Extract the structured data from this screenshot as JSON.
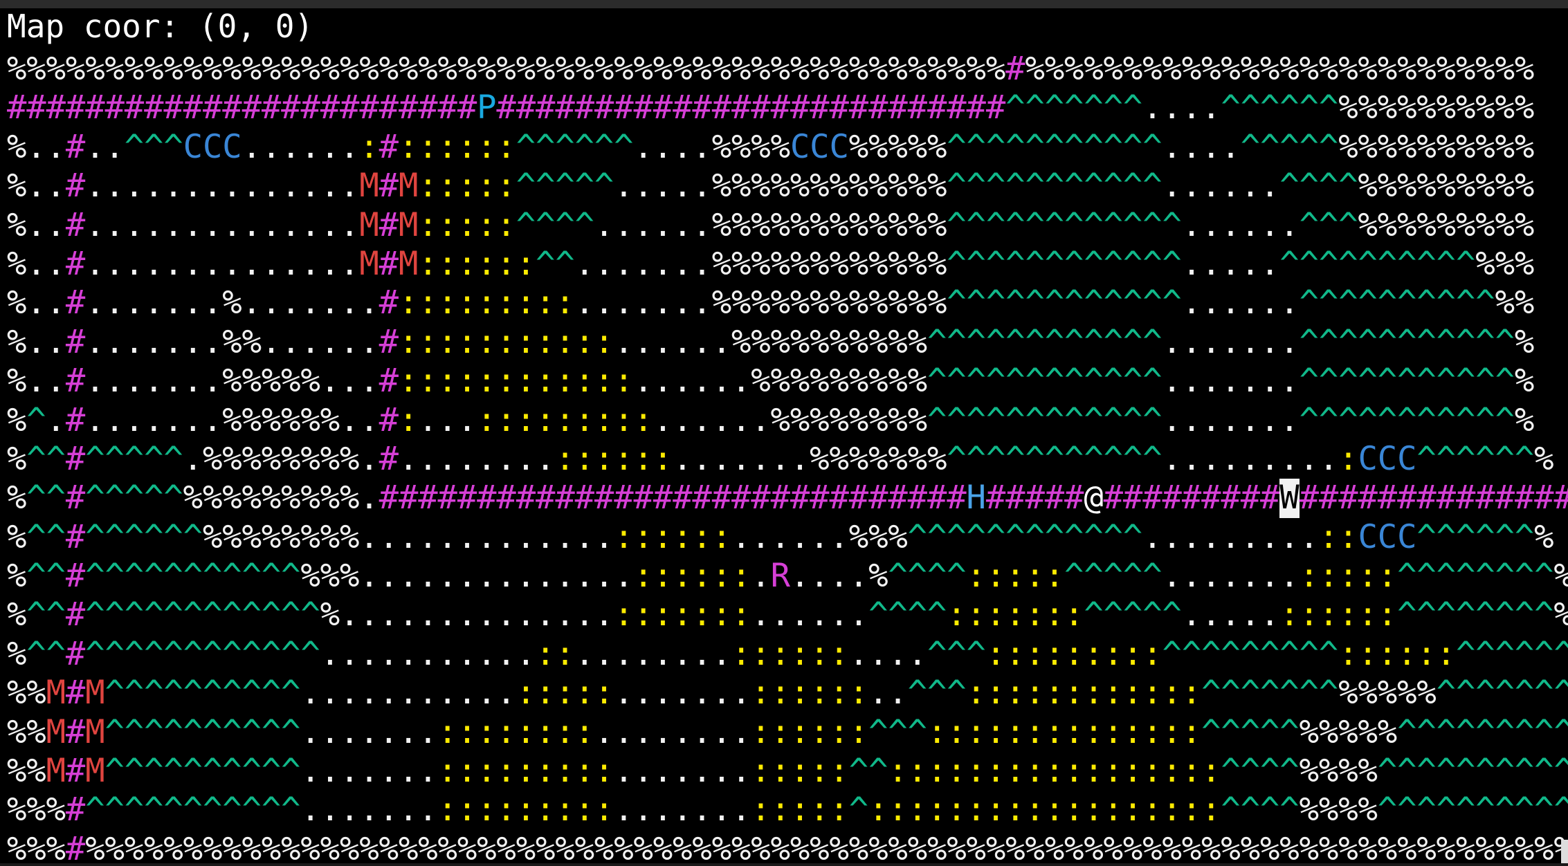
{
  "status": {
    "label": "Map coor: (0, 0)"
  },
  "legend": {
    "%": "c-rock",
    "#": "c-wall",
    ".": "c-floor",
    ":": "c-grass",
    "^": "c-mount",
    "C": "c-tree",
    "M": "c-mon",
    "P": "c-shop",
    "H": "c-unit",
    "R": "c-npc",
    "@": "c-player",
    "W": "c-cursor"
  },
  "grid": [
    "%%%%%%%%%%%%%%%%%%%%%%%%%%%%%%%%%%%%%%%%%%%%%%%%%%%#%%%%%%%%%%%%%%%%%%%%%%%%%%",
    "########################P##########################^^^^^^^....^^^^^^%%%%%%%%%%",
    "%..#..^^^CCC......:#::::::^^^^^^....%%%%CCC%%%%%^^^^^^^^^^^....^^^^^%%%%%%%%%%",
    "%..#..............M#M:::::^^^^^.....%%%%%%%%%%%%^^^^^^^^^^^......^^^^%%%%%%%%%",
    "%..#..............M#M:::::^^^^......%%%%%%%%%%%%^^^^^^^^^^^^......^^^%%%%%%%%%",
    "%..#..............M#M::::::^^.......%%%%%%%%%%%%^^^^^^^^^^^^.....^^^^^^^^^^%%%",
    "%..#.......%.......#:::::::::.......%%%%%%%%%%%%^^^^^^^^^^^^......^^^^^^^^^^%%",
    "%..#.......%%......#:::::::::::......%%%%%%%%%%^^^^^^^^^^^^.......^^^^^^^^^^^%",
    "%..#.......%%%%%...#::::::::::::......%%%%%%%%%^^^^^^^^^^^^.......^^^^^^^^^^^%",
    "%^.#.......%%%%%%..#:...:::::::::......%%%%%%%%^^^^^^^^^^^^.......^^^^^^^^^^^%",
    "%^^#^^^^^.%%%%%%%%.#........::::::.......%%%%%%%^^^^^^^^^^^.........:CCC^^^^^^%",
    "%^^#^^^^^%%%%%%%%%.##############################H#####@#########W###############",
    "%^^#^^^^^^%%%%%%%%.............::::::......%%%^^^^^^^^^^^^.........::CCC^^^^^^%",
    "%^^#^^^^^^^^^^^%%%..............::::::.R....%^^^^:::::^^^^^.......:::::^^^^^^^^%",
    "%^^#^^^^^^^^^^^^%..............:::::::......^^^^:::::::^^^^^.....::::::^^^^^^^^%",
    "%^^#^^^^^^^^^^^^...........::........::::::....^^^:::::::::^^^^^^^^^::::::^^^^^^^%",
    "%%M#M^^^^^^^^^^...........:::::.......::::::..^^^::::::::::::^^^^^^^%%%%%^^^^^^^^%",
    "%%M#M^^^^^^^^^^.......::::::::........::::::^^^::::::::::::::^^^^^%%%%%^^^^^^^^^^%",
    "%%M#M^^^^^^^^^^.......:::::::::.......:::::^^:::::::::::::::::^^^^%%%%^^^^^^^^^^^%",
    "%%%#^^^^^^^^^^^.......:::::::::.......:::::^::::::::::::::::::^^^^%%%%^^^^^^^^^^^%",
    "%%%#%%%%%%%%%%%%%%%%%%%%%%%%%%%%%%%%%%%%%%%%%%%%%%%%%%%%%%%%%%%%%%%%%%%%%%%%%%%%"
  ]
}
